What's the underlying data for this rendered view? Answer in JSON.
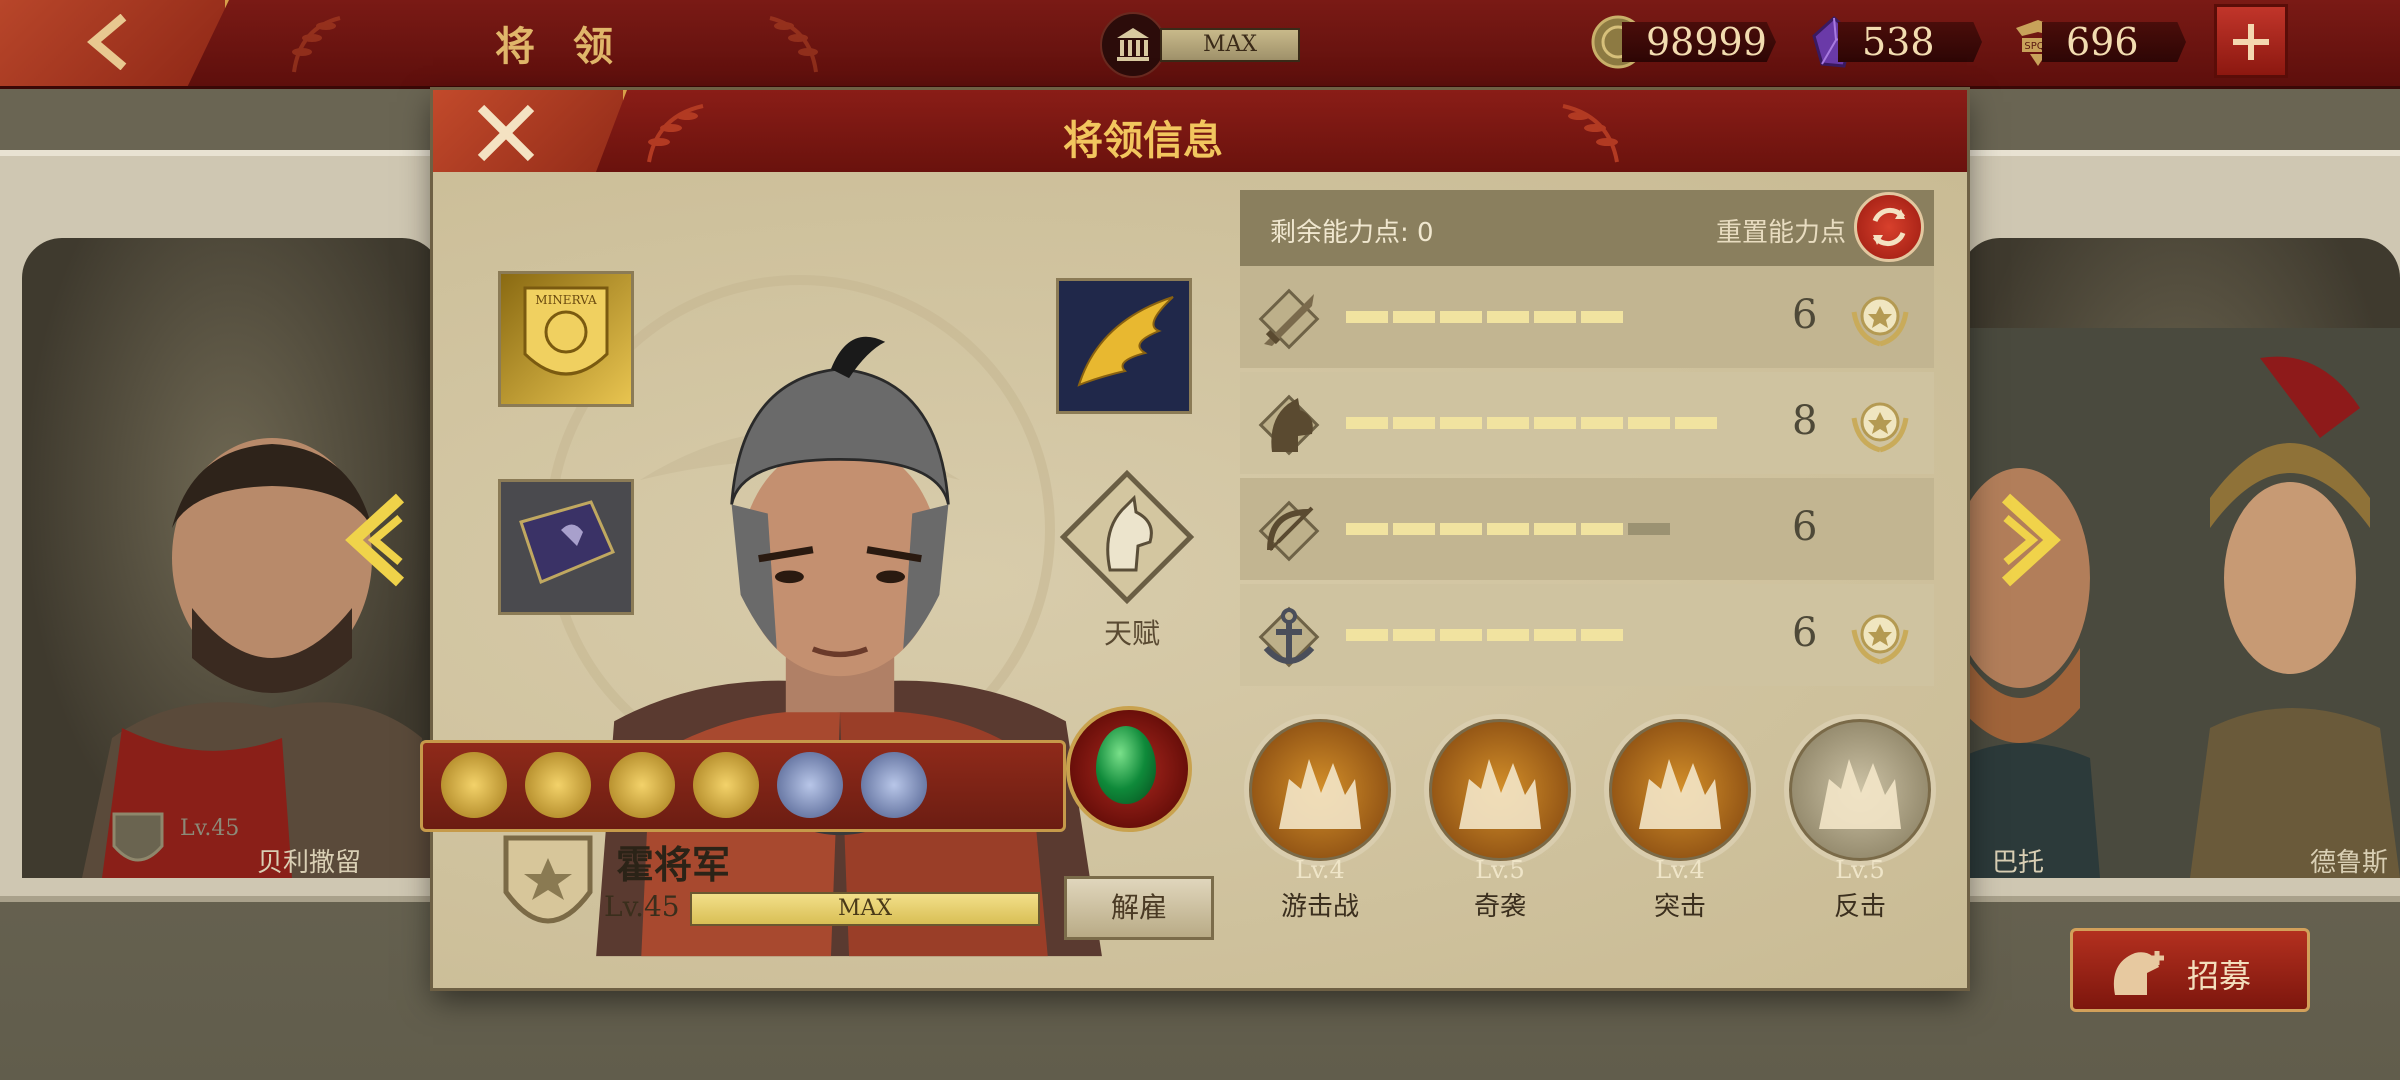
{
  "topbar": {
    "title": "将 领",
    "max_label": "MAX",
    "gold": "98999",
    "gems": "538",
    "spqr": "696",
    "colors": {
      "bar": "#6a120d",
      "accent": "#d8a04a"
    }
  },
  "side_left": {
    "name": "贝利撒留",
    "level": "Lv.45"
  },
  "side_right": {
    "name1": "巴托",
    "name2": "德鲁斯"
  },
  "recruit_label": "招募",
  "modal": {
    "title": "将领信息",
    "talent_label": "天赋",
    "hero": {
      "name": "霍将军",
      "level": "Lv.45",
      "xp_label": "MAX",
      "xp_fraction": 1.0
    },
    "dismiss_label": "解雇",
    "stats": {
      "remaining_label": "剩余能力点: 0",
      "reset_label": "重置能力点",
      "rows": [
        {
          "icon": "sword-icon",
          "value": "6",
          "filled": 6,
          "total": 6,
          "star": true
        },
        {
          "icon": "horse-icon",
          "value": "8",
          "filled": 8,
          "total": 8,
          "star": true
        },
        {
          "icon": "bow-icon",
          "value": "6",
          "filled": 6,
          "total": 7,
          "star": false
        },
        {
          "icon": "anchor-icon",
          "value": "6",
          "filled": 6,
          "total": 6,
          "star": true
        }
      ]
    },
    "tactics": [
      {
        "level": "Lv.4",
        "name": "游击战",
        "tone": "bronze"
      },
      {
        "level": "Lv.5",
        "name": "奇袭",
        "tone": "bronze"
      },
      {
        "level": "Lv.4",
        "name": "突击",
        "tone": "bronze"
      },
      {
        "level": "Lv.5",
        "name": "反击",
        "tone": "grey"
      }
    ]
  }
}
